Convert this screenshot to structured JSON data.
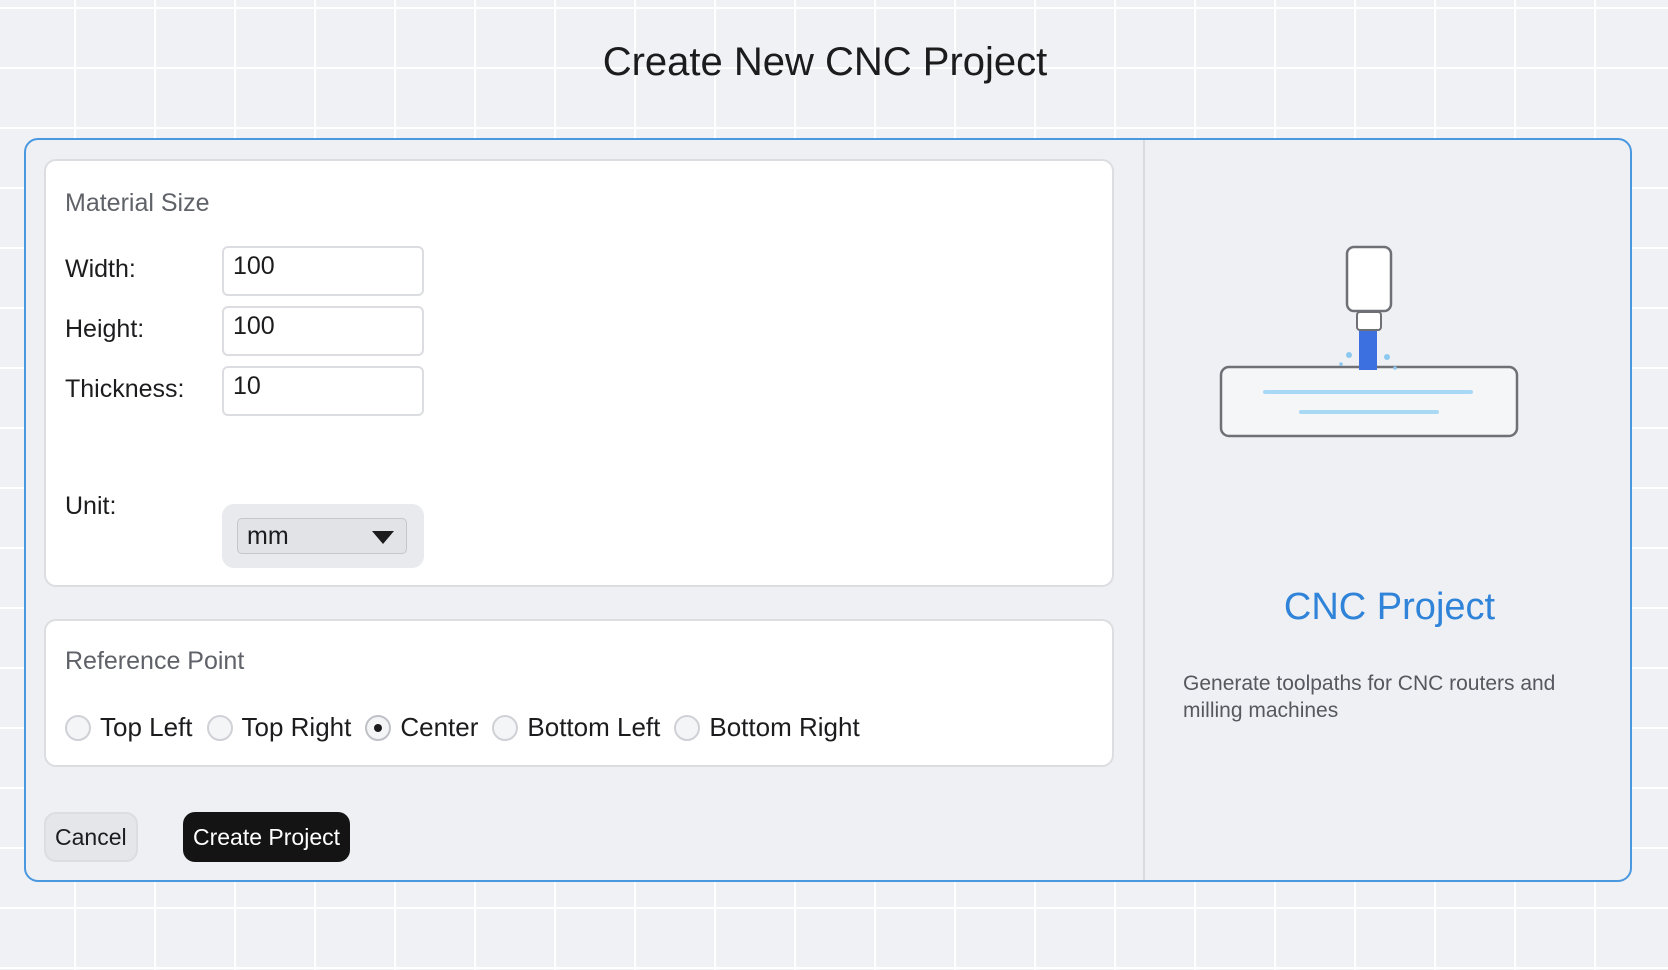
{
  "page": {
    "title": "Create New CNC Project"
  },
  "material": {
    "section_title": "Material Size",
    "width_label": "Width:",
    "width_value": "100",
    "height_label": "Height:",
    "height_value": "100",
    "thickness_label": "Thickness:",
    "thickness_value": "10",
    "unit_label": "Unit:",
    "unit_value": "mm"
  },
  "reference": {
    "section_title": "Reference Point",
    "options": [
      "Top Left",
      "Top Right",
      "Center",
      "Bottom Left",
      "Bottom Right"
    ],
    "selected": "Center"
  },
  "actions": {
    "cancel_label": "Cancel",
    "create_label": "Create Project"
  },
  "info": {
    "title": "CNC Project",
    "description": "Generate toolpaths for CNC routers and milling machines",
    "icon": "cnc-machine-icon"
  },
  "colors": {
    "accent": "#2f83d8",
    "dialog_border": "#4a98e0",
    "primary_button": "#141414",
    "tool_bit": "#3c6fe0",
    "cut_lines": "#a9d8f4"
  }
}
